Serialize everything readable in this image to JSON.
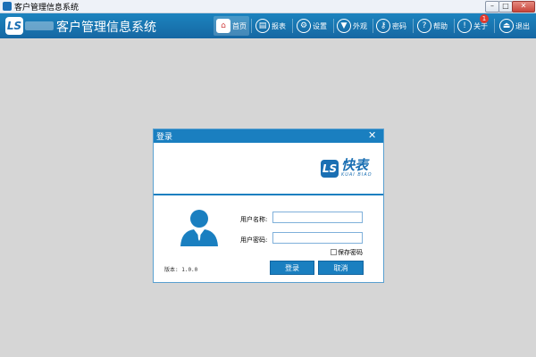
{
  "window": {
    "title": "客户管理信息系统",
    "controls": {
      "minimize": "–",
      "maximize": "□",
      "close": "✕"
    }
  },
  "header": {
    "logo_text": "LS",
    "app_title": "客户管理信息系统",
    "nav": [
      {
        "label": "首页",
        "icon": "home-icon",
        "glyph": "⌂"
      },
      {
        "label": "报表",
        "icon": "report-icon",
        "glyph": "▤"
      },
      {
        "label": "设置",
        "icon": "gear-icon",
        "glyph": "⚙"
      },
      {
        "label": "外观",
        "icon": "shirt-icon",
        "glyph": "▼"
      },
      {
        "label": "密码",
        "icon": "key-icon",
        "glyph": "⚷"
      },
      {
        "label": "帮助",
        "icon": "help-icon",
        "glyph": "?"
      },
      {
        "label": "关于",
        "icon": "about-icon",
        "glyph": "!",
        "badge": "1"
      },
      {
        "label": "退出",
        "icon": "exit-icon",
        "glyph": "⏏"
      }
    ]
  },
  "dialog": {
    "title": "登录",
    "close": "✕",
    "brand": {
      "mark": "LS",
      "name": "快表",
      "name_en": "KUAI BIAO"
    },
    "username_label": "用户名称:",
    "username_value": "",
    "password_label": "用户密码:",
    "password_value": "",
    "save_password_label": "保存密码",
    "save_password_checked": false,
    "login_button": "登录",
    "cancel_button": "取消",
    "version": "版本: 1.0.0"
  },
  "colors": {
    "accent": "#1a7fc0",
    "badge": "#e03a2e",
    "background": "#d6d6d6"
  }
}
